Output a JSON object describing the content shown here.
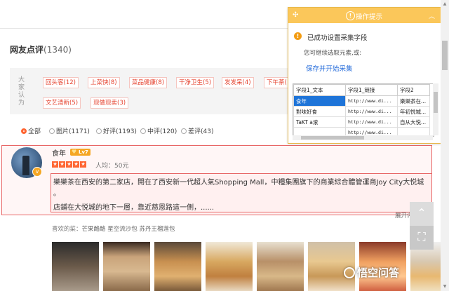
{
  "reviews": {
    "heading": "网友点评",
    "count": "(1340)",
    "side_label": [
      "大",
      "家",
      "认",
      "为"
    ],
    "tags": [
      "回头客(12)",
      "上菜快(8)",
      "菜品健康(8)",
      "干净卫生(5)",
      "发发呆(4)",
      "下午茶(",
      "文艺清新(5)",
      "现做现卖(3)"
    ],
    "filters": [
      "全部",
      "图片(1171)",
      "好评(1193)",
      "中评(120)",
      "差评(43)"
    ],
    "item": {
      "username": "食年",
      "level": "Lv7",
      "avatar_badge": "v",
      "avg_price": "人均：50元",
      "text_line1": "樂樂茶在西安的第二家店，開在了西安新一代超人氣Shopping Mall，中糧集團旗下的商業綜合體管運商Joy City大悦城",
      "text_line2": "。",
      "text_line3": "店鋪在大悦城的地下一層，靠近慈恩路這一側，......",
      "expand": "展开评论",
      "liked_label": "喜欢的菜：",
      "liked_dishes": [
        "芒果酪酪",
        "星空流沙包",
        "苏丹王榴莲包"
      ]
    }
  },
  "panel": {
    "title": "操作提示",
    "success": "已成功设置采集字段",
    "hint": "您可继续选取元素,或:",
    "save": "保存并开始采集",
    "columns": [
      "字段1_文本",
      "字段1_链接",
      "字段2"
    ],
    "rows": [
      [
        "食年",
        "http://www.di...",
        "樂樂茶在..."
      ],
      [
        "對味好食",
        "http://www.di...",
        "年初悦城..."
      ],
      [
        "TaKT a滚",
        "http://www.di...",
        "自从大悦..."
      ],
      [
        "",
        "http://www.di...",
        ""
      ]
    ]
  },
  "watermark": "悟空问答",
  "colors": {
    "accent": "#ff6633",
    "tag_red": "#e5412d",
    "panel_header": "#fbc75a",
    "link_blue": "#2a6fdb"
  }
}
